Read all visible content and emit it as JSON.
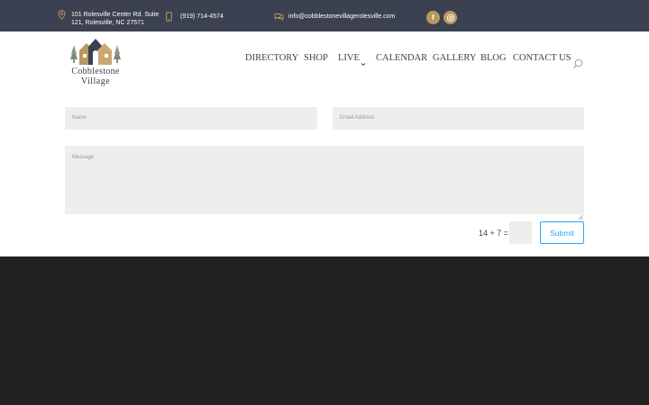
{
  "topbar": {
    "address_line1": "101 Rolesville Center Rd. Suite",
    "address_line2": "121, Rolesville, NC 27571",
    "phone": "(919) 714-4574",
    "email": "info@cobblestonevillagerolesville.com",
    "icons": [
      "location-pin-icon",
      "phone-icon",
      "chat-icon",
      "facebook-icon",
      "instagram-icon"
    ],
    "background": "#3b4150",
    "social_color": "#b89860"
  },
  "logo": {
    "line1": "Cobblestone",
    "line2": "Village"
  },
  "nav": {
    "items": [
      "DIRECTORY",
      "SHOP",
      "LIVE",
      "CALENDAR",
      "GALLERY",
      "BLOG",
      "CONTACT US"
    ],
    "dropdown_item": "LIVE"
  },
  "form": {
    "name_placeholder": "Name",
    "email_placeholder": "Email Address",
    "message_placeholder": "Message",
    "captcha_question": "14 + 7 =",
    "captcha_value": "",
    "submit_label": "Submit",
    "accent": "#2ea3f2"
  },
  "footer": {
    "background": "#222222"
  }
}
